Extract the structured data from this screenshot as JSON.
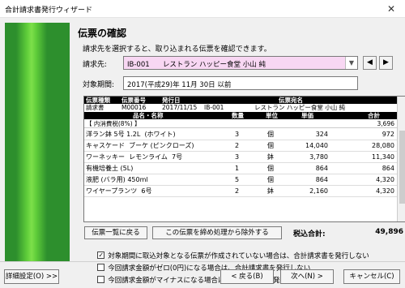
{
  "window": {
    "title": "合計請求書発行ウィザード",
    "close_glyph": "✕"
  },
  "page": {
    "heading": "伝票の確認",
    "description": "請求先を選択すると、取り込まれる伝票を確認できます。",
    "customer_label": "請求先:",
    "customer_value": "IB-001      レストラン ハッピー食堂 小山 純",
    "period_label": "対象期間:",
    "period_value": "2017(平成29)年 11月 30日  以前"
  },
  "slip": {
    "header_labels": {
      "type": "伝票種類",
      "number": "伝票番号",
      "date": "発行日",
      "addressee": "伝票宛名"
    },
    "type": "請求書",
    "number": "M00016",
    "date": "2017/11/15",
    "customer_code": "IB-001",
    "addressee": "レストラン ハッピー食堂 小山 純",
    "columns": {
      "item": "品名・名称",
      "qty": "数量",
      "unit": "単位",
      "price": "単価",
      "amount": "合計"
    },
    "group_label": "【 内消費税(8%) 】",
    "group_amount": "3,696",
    "items": [
      {
        "name": "洋ラン鉢 5号 1.2L  (ホワイト)",
        "qty": "3",
        "unit": "個",
        "price": "324",
        "amount": "972"
      },
      {
        "name": "キャスケード  ブーケ (ピンクローズ)",
        "qty": "2",
        "unit": "個",
        "price": "14,040",
        "amount": "28,080"
      },
      {
        "name": "ワーネッキー  レモンライム  7号",
        "qty": "3",
        "unit": "鉢",
        "price": "3,780",
        "amount": "11,340"
      },
      {
        "name": "有機培養土 (5L)",
        "qty": "1",
        "unit": "個",
        "price": "864",
        "amount": "864"
      },
      {
        "name": "液肥 (バラ用) 450ml",
        "qty": "5",
        "unit": "個",
        "price": "864",
        "amount": "4,320"
      },
      {
        "name": "ワイヤープランツ  6号",
        "qty": "2",
        "unit": "鉢",
        "price": "2,160",
        "amount": "4,320"
      }
    ]
  },
  "actions": {
    "slip_list": "伝票一覧に戻る",
    "exclude": "この伝票を締め処理から除外する",
    "total_label": "税込合計:",
    "total_value": "49,896"
  },
  "options": [
    {
      "checked": true,
      "label": "対象期間に取込対象となる伝票が作成されていない場合は、合計請求書を発行しない"
    },
    {
      "checked": false,
      "label": "今回請求金額がゼロ(0円)になる場合は、合計請求書を発行しない"
    },
    {
      "checked": false,
      "label": "今回請求金額がマイナスになる場合は、合計請求書を発行しない"
    }
  ],
  "footer": {
    "details": "詳細設定(O) >>",
    "back": "< 戻る(B)",
    "next": "次へ(N) >",
    "cancel": "キャンセル(C)"
  },
  "icons": {
    "dropdown": "chevron-down-icon",
    "prev": "left-triangle-icon",
    "next": "right-triangle-icon"
  },
  "colors": {
    "combo_bg": "#f8d7f3",
    "side_panel": "#2d8f2d",
    "header_black": "#000000"
  }
}
